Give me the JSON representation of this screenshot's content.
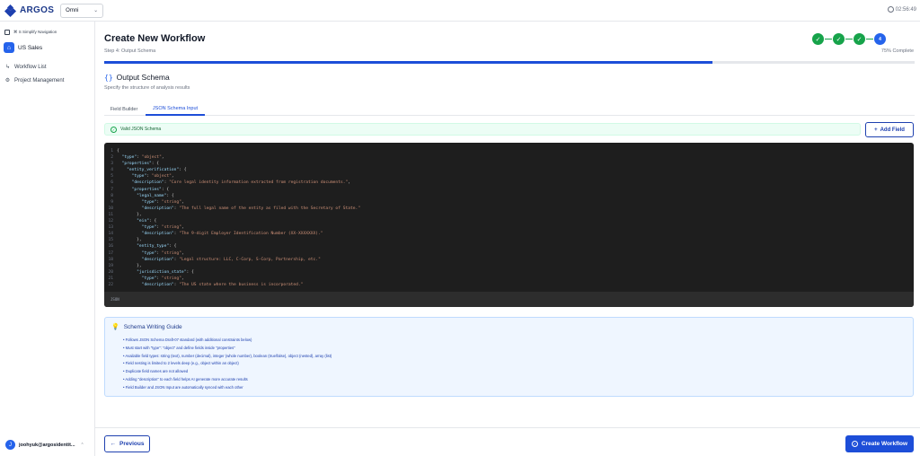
{
  "app": {
    "logo_text": "ARGOS",
    "org_select": "Omni",
    "clock": "02:56:49"
  },
  "sidebar": {
    "simplify_nav": "⌘ S Simplify Navigation",
    "workspace": "US Sales",
    "items": [
      {
        "label": "Workflow List",
        "icon": "list-icon"
      },
      {
        "label": "Project Management",
        "icon": "gear-icon"
      }
    ],
    "user_email": "joohyuk@argosidentit...",
    "user_initial": "J"
  },
  "header": {
    "title": "Create New Workflow",
    "subtitle": "Step 4: Output Schema",
    "percent_label": "75% Complete",
    "progress": 0.75,
    "current_step": "4"
  },
  "section": {
    "icon": "{}",
    "title": "Output Schema",
    "subtitle": "Specify the structure of analysis results"
  },
  "tabs": [
    {
      "label": "Field Builder",
      "active": false
    },
    {
      "label": "JSON Schema Input",
      "active": true
    }
  ],
  "validation": {
    "text": "Valid JSON Schema",
    "color": "#16a34a"
  },
  "add_field_label": "Add Field",
  "editor": {
    "language": "JSON",
    "lines": [
      {
        "n": "1",
        "indent": 0,
        "tokens": [
          [
            "{",
            "#d4d4d4"
          ]
        ]
      },
      {
        "n": "2",
        "indent": 1,
        "tokens": [
          [
            "\"type\"",
            "#9cdcfe"
          ],
          [
            ": ",
            "#d4d4d4"
          ],
          [
            "\"object\"",
            "#ce9178"
          ],
          [
            ",",
            "#d4d4d4"
          ]
        ]
      },
      {
        "n": "3",
        "indent": 1,
        "tokens": [
          [
            "\"properties\"",
            "#9cdcfe"
          ],
          [
            ": {",
            "#d4d4d4"
          ]
        ]
      },
      {
        "n": "4",
        "indent": 2,
        "tokens": [
          [
            "\"entity_verification\"",
            "#9cdcfe"
          ],
          [
            ": {",
            "#d4d4d4"
          ]
        ]
      },
      {
        "n": "5",
        "indent": 3,
        "tokens": [
          [
            "\"type\"",
            "#9cdcfe"
          ],
          [
            ": ",
            "#d4d4d4"
          ],
          [
            "\"object\"",
            "#ce9178"
          ],
          [
            ",",
            "#d4d4d4"
          ]
        ]
      },
      {
        "n": "6",
        "indent": 3,
        "tokens": [
          [
            "\"description\"",
            "#9cdcfe"
          ],
          [
            ": ",
            "#d4d4d4"
          ],
          [
            "\"Core legal identity information extracted from registration documents.\"",
            "#ce9178"
          ],
          [
            ",",
            "#d4d4d4"
          ]
        ]
      },
      {
        "n": "7",
        "indent": 3,
        "tokens": [
          [
            "\"properties\"",
            "#9cdcfe"
          ],
          [
            ": {",
            "#d4d4d4"
          ]
        ]
      },
      {
        "n": "8",
        "indent": 4,
        "tokens": [
          [
            "\"legal_name\"",
            "#9cdcfe"
          ],
          [
            ": {",
            "#d4d4d4"
          ]
        ]
      },
      {
        "n": "9",
        "indent": 5,
        "tokens": [
          [
            "\"type\"",
            "#9cdcfe"
          ],
          [
            ": ",
            "#d4d4d4"
          ],
          [
            "\"string\"",
            "#ce9178"
          ],
          [
            ",",
            "#d4d4d4"
          ]
        ]
      },
      {
        "n": "10",
        "indent": 5,
        "tokens": [
          [
            "\"description\"",
            "#9cdcfe"
          ],
          [
            ": ",
            "#d4d4d4"
          ],
          [
            "\"The full legal name of the entity as filed with the Secretary of State.\"",
            "#ce9178"
          ]
        ]
      },
      {
        "n": "11",
        "indent": 4,
        "tokens": [
          [
            "},",
            "#d4d4d4"
          ]
        ]
      },
      {
        "n": "12",
        "indent": 4,
        "tokens": [
          [
            "\"ein\"",
            "#9cdcfe"
          ],
          [
            ": {",
            "#d4d4d4"
          ]
        ]
      },
      {
        "n": "13",
        "indent": 5,
        "tokens": [
          [
            "\"type\"",
            "#9cdcfe"
          ],
          [
            ": ",
            "#d4d4d4"
          ],
          [
            "\"string\"",
            "#ce9178"
          ],
          [
            ",",
            "#d4d4d4"
          ]
        ]
      },
      {
        "n": "14",
        "indent": 5,
        "tokens": [
          [
            "\"description\"",
            "#9cdcfe"
          ],
          [
            ": ",
            "#d4d4d4"
          ],
          [
            "\"The 9-digit Employer Identification Number (XX-XXXXXXX).\"",
            "#ce9178"
          ]
        ]
      },
      {
        "n": "15",
        "indent": 4,
        "tokens": [
          [
            "},",
            "#d4d4d4"
          ]
        ]
      },
      {
        "n": "16",
        "indent": 4,
        "tokens": [
          [
            "\"entity_type\"",
            "#9cdcfe"
          ],
          [
            ": {",
            "#d4d4d4"
          ]
        ]
      },
      {
        "n": "17",
        "indent": 5,
        "tokens": [
          [
            "\"type\"",
            "#9cdcfe"
          ],
          [
            ": ",
            "#d4d4d4"
          ],
          [
            "\"string\"",
            "#ce9178"
          ],
          [
            ",",
            "#d4d4d4"
          ]
        ]
      },
      {
        "n": "18",
        "indent": 5,
        "tokens": [
          [
            "\"description\"",
            "#9cdcfe"
          ],
          [
            ": ",
            "#d4d4d4"
          ],
          [
            "\"Legal structure: LLC, C-Corp, S-Corp, Partnership, etc.\"",
            "#ce9178"
          ]
        ]
      },
      {
        "n": "19",
        "indent": 4,
        "tokens": [
          [
            "},",
            "#d4d4d4"
          ]
        ]
      },
      {
        "n": "20",
        "indent": 4,
        "tokens": [
          [
            "\"jurisdiction_state\"",
            "#9cdcfe"
          ],
          [
            ": {",
            "#d4d4d4"
          ]
        ]
      },
      {
        "n": "21",
        "indent": 5,
        "tokens": [
          [
            "\"type\"",
            "#9cdcfe"
          ],
          [
            ": ",
            "#d4d4d4"
          ],
          [
            "\"string\"",
            "#ce9178"
          ],
          [
            ",",
            "#d4d4d4"
          ]
        ]
      },
      {
        "n": "22",
        "indent": 5,
        "tokens": [
          [
            "\"description\"",
            "#9cdcfe"
          ],
          [
            ": ",
            "#d4d4d4"
          ],
          [
            "\"The US state where the business is incorporated.\"",
            "#ce9178"
          ]
        ]
      }
    ]
  },
  "guide": {
    "title": "Schema Writing Guide",
    "items": [
      "• Follows JSON Schema Draft-07 standard (with additional constraints below)",
      "• Must start with \"type\": \"object\" and define fields inside \"properties\"",
      "• Available field types: string (text), number (decimal), integer (whole number), boolean (true/false), object (nested), array (list)",
      "• Field nesting is limited to 2 levels deep (e.g., object within an object)",
      "• Duplicate field names are not allowed",
      "• Adding \"description\" to each field helps AI generate more accurate results",
      "• Field Builder and JSON Input are automatically synced with each other"
    ]
  },
  "footer": {
    "previous_label": "Previous",
    "create_label": "Create Workflow"
  },
  "colors": {
    "accent": "#1d4ed8",
    "success": "#16a34a",
    "editor_bg": "#1e1e1e"
  }
}
